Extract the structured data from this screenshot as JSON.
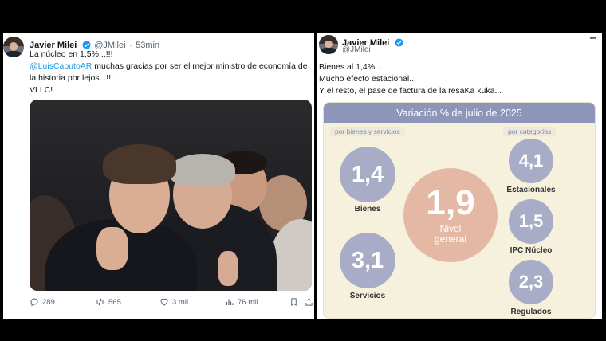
{
  "left_tweet": {
    "author_name": "Javier Milei",
    "author_handle": "@JMilei",
    "time_ago": "53min",
    "line1": "La núcleo en 1,5%...!!!",
    "mention": "@LuisCaputoAR",
    "line2_rest": " muchas gracias por ser el mejor ministro de economía de",
    "line3": "la historia por lejos...!!!",
    "line4": "VLLC!",
    "actions": {
      "replies": "289",
      "retweets": "565",
      "likes": "3 mil",
      "views": "76 mil"
    }
  },
  "right_tweet": {
    "author_name": "Javier Milei",
    "author_handle": "@JMilei",
    "more_icon": "•••",
    "line1": "Bienes al 1,4%...",
    "line2": "Mucho efecto estacional...",
    "line3": "Y el resto, el pase de factura de la resaKa kuka...",
    "infographic": {
      "title": "Variación % de julio de 2025",
      "left_sublabel": "por bienes y servicios",
      "right_sublabel": "por categorías",
      "bienes_value": "1,4",
      "bienes_label": "Bienes",
      "servicios_value": "3,1",
      "servicios_label": "Servicios",
      "general_value": "1,9",
      "general_label_1": "Nivel",
      "general_label_2": "general",
      "estacionales_value": "4,1",
      "estacionales_label": "Estacionales",
      "nucleo_value": "1,5",
      "nucleo_label": "IPC Núcleo",
      "regulados_value": "2,3",
      "regulados_label": "Regulados"
    }
  },
  "colors": {
    "link": "#1d9bf0",
    "verified": "#1d9bf0",
    "header": "#8d95b8",
    "general_circle": "#e5b8a6",
    "small_circle": "#a9acc7"
  }
}
